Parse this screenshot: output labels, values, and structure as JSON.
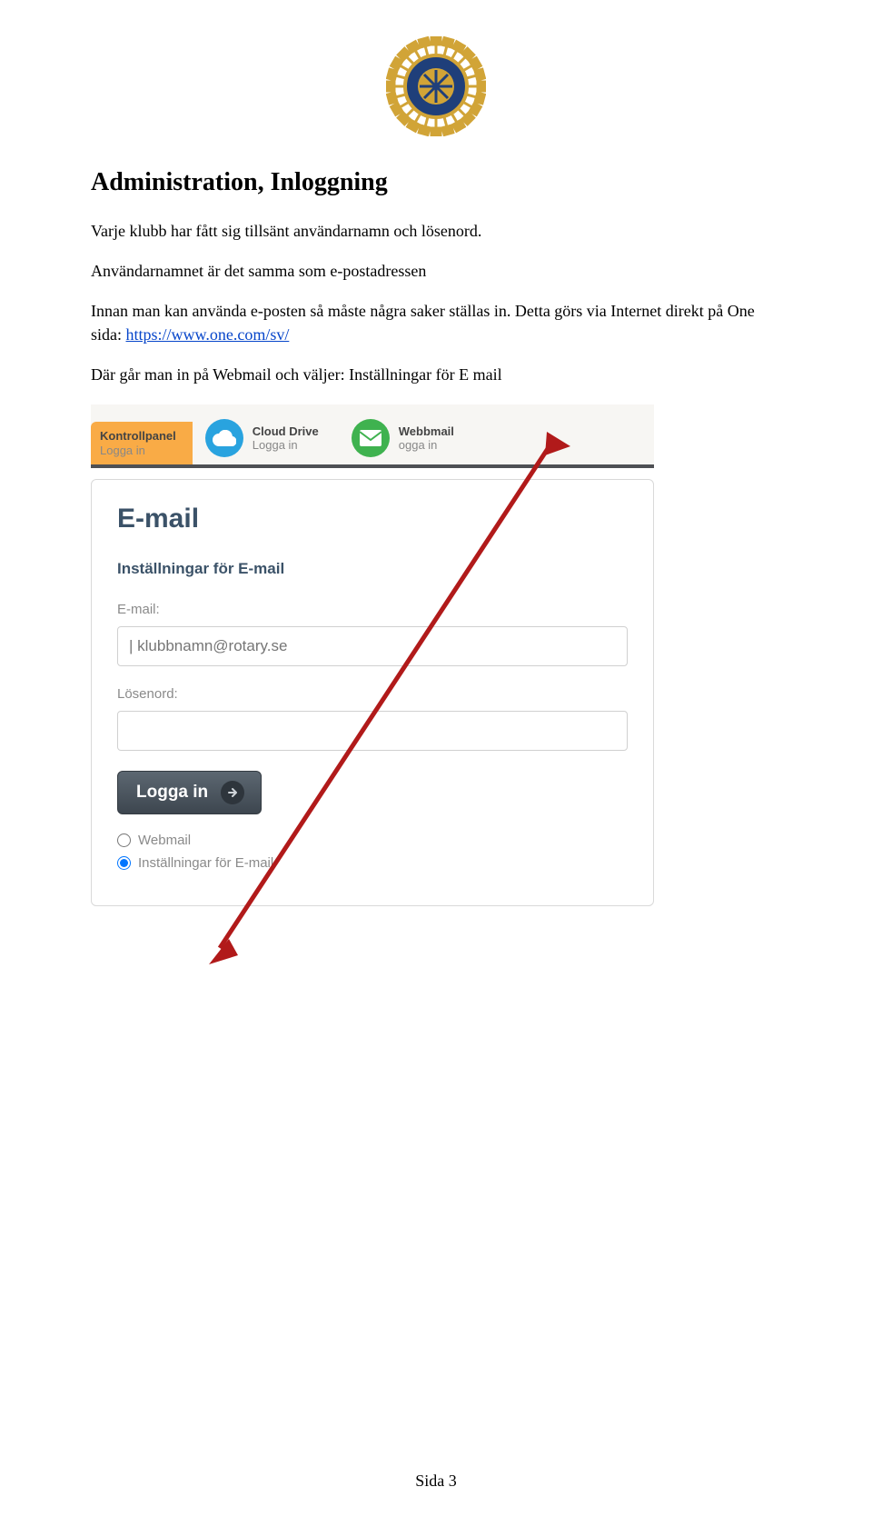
{
  "doc": {
    "heading": "Administration, Inloggning",
    "p1": "Varje klubb har fått sig tillsänt användarnamn och lösenord.",
    "p2": "Användarnamnet är det samma som e-postadressen",
    "p3_a": "Innan man kan använda e-posten så måste några saker ställas in. Detta görs via Internet direkt på One sida: ",
    "p3_link": "https://www.one.com/sv/",
    "p4": "Där går man in på Webmail och väljer: Inställningar för E mail",
    "footer": "Sida 3"
  },
  "tabs": {
    "kontroll": {
      "l1": "Kontrollpanel",
      "l2": "Logga in"
    },
    "cloud": {
      "l1": "Cloud Drive",
      "l2": "Logga in"
    },
    "webmail": {
      "l1": "Webbmail",
      "l2": "ogga in"
    }
  },
  "panel": {
    "title": "E-mail",
    "subtitle": "Inställningar för E-mail",
    "email_label": "E-mail:",
    "email_value": "| klubbnamn@rotary.se",
    "password_label": "Lösenord:",
    "login_btn": "Logga in",
    "radio_webmail": "Webmail",
    "radio_settings": "Inställningar för E-mail"
  }
}
